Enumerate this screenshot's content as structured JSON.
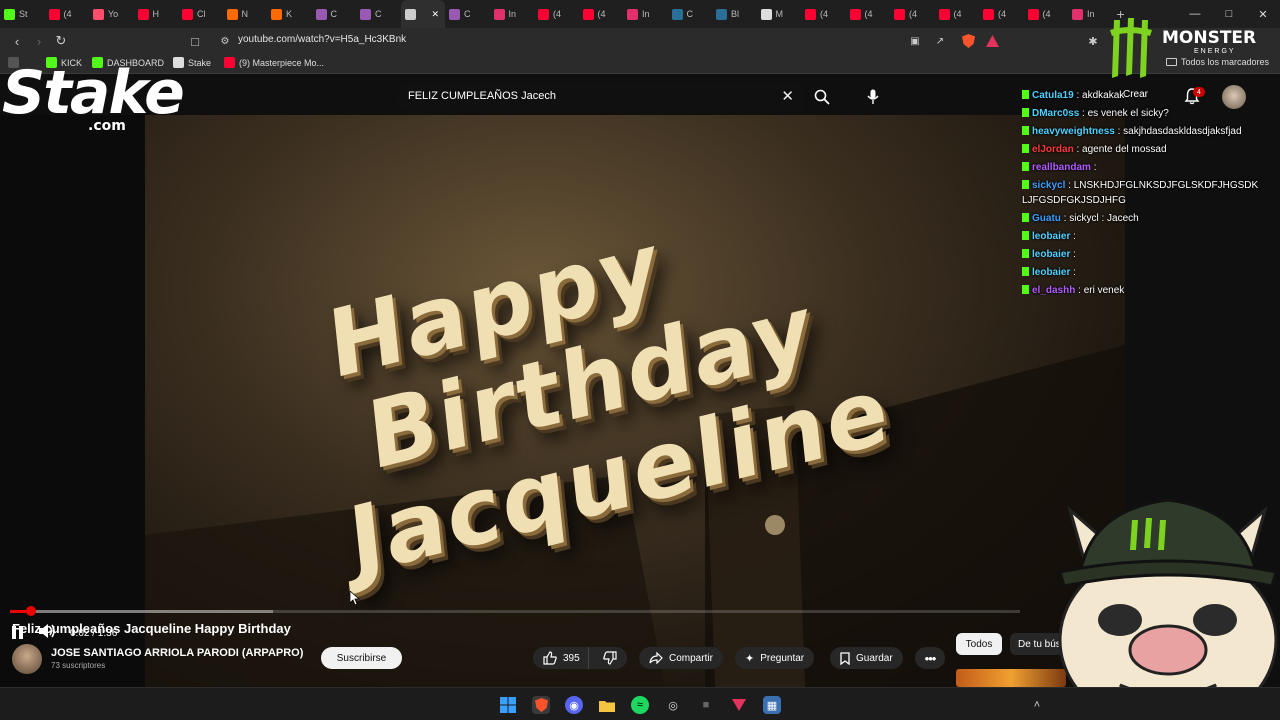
{
  "browser": {
    "tabs": [
      {
        "label": "St",
        "color": "#53fc18"
      },
      {
        "label": "(4",
        "color": "#ff0033"
      },
      {
        "label": "Yo",
        "color": "#ff4d6d"
      },
      {
        "label": "H",
        "color": "#ff0033"
      },
      {
        "label": "Cl",
        "color": "#ff0033"
      },
      {
        "label": "N",
        "color": "#ff6a00"
      },
      {
        "label": "K",
        "color": "#ff6a00"
      },
      {
        "label": "C",
        "color": "#9b59b6"
      },
      {
        "label": "C",
        "color": "#9b59b6"
      },
      {
        "label": "",
        "color": "#cccccc"
      },
      {
        "label": "C",
        "color": "#9b59b6"
      },
      {
        "label": "In",
        "color": "#e1306c"
      },
      {
        "label": "(4",
        "color": "#ff0033"
      },
      {
        "label": "(4",
        "color": "#ff0033"
      },
      {
        "label": "In",
        "color": "#e1306c"
      },
      {
        "label": "C",
        "color": "#2a6f97"
      },
      {
        "label": "Bl",
        "color": "#2a6f97"
      },
      {
        "label": "M",
        "color": "#dddddd"
      },
      {
        "label": "(4",
        "color": "#ff0033"
      },
      {
        "label": "(4",
        "color": "#ff0033"
      },
      {
        "label": "(4",
        "color": "#ff0033"
      },
      {
        "label": "(4",
        "color": "#ff0033"
      },
      {
        "label": "(4",
        "color": "#ff0033"
      },
      {
        "label": "(4",
        "color": "#ff0033"
      },
      {
        "label": "In",
        "color": "#e1306c"
      }
    ],
    "new_tab": "+",
    "url": "youtube.com/watch?v=H5a_Hc3KBnk",
    "bookmarks": [
      {
        "label": "KICK",
        "color": "#53fc18"
      },
      {
        "label": "DASHBOARD",
        "color": "#53fc18"
      },
      {
        "label": "Stake",
        "color": "#dddddd"
      },
      {
        "label": "(9) Masterpiece Mo...",
        "color": "#ff0033"
      }
    ],
    "all_bookmarks": "Todos los marcadores"
  },
  "youtube": {
    "search_query": "FELIZ CUMPLEAÑOS Jacech",
    "create_label": "Crear",
    "notif_count": "4",
    "video": {
      "overlay_lines": [
        "Happy",
        "Birthday",
        "Jacqueline"
      ],
      "current_time": "0:02",
      "duration": "1:36",
      "timecode": "0:02 / 1:36",
      "played_fraction": 0.021,
      "buffered_fraction": 0.26
    },
    "title": "Feliz cumpleaños Jacqueline Happy Birthday",
    "channel": "JOSE SANTIAGO ARRIOLA PARODI (ARPAPRO)",
    "subscribers": "73 suscriptores",
    "subscribe_label": "Suscribirse",
    "likes": "395",
    "share_label": "Compartir",
    "ask_label": "Preguntar",
    "save_label": "Guardar",
    "filters": [
      "Todos",
      "De tu búsq"
    ]
  },
  "chat": [
    {
      "user": "Catula19",
      "color": "#4fd1ff",
      "text": ": akdkakak"
    },
    {
      "user": "DMarc0ss",
      "color": "#4fd1ff",
      "text": ": es venek el sicky?"
    },
    {
      "user": "heavyweightness",
      "color": "#4fd1ff",
      "text": ": sakjhdasdaskldasdjaksfjad"
    },
    {
      "user": "elJordan",
      "color": "#ff3b3b",
      "text": ": agente del mossad"
    },
    {
      "user": "reallbandam",
      "color": "#b15cff",
      "text": ":"
    },
    {
      "user": "sickycl",
      "color": "#3aa0ff",
      "text": ": LNSKHDJFGLNKSDJFGLSKDFJHGSDKLJFGSDFGKJSDJHFG"
    },
    {
      "user": "Guatu",
      "color": "#3aa0ff",
      "text": ": sickycl : Jacech"
    },
    {
      "user": "leobaier",
      "color": "#4fd1ff",
      "text": ":"
    },
    {
      "user": "leobaier",
      "color": "#4fd1ff",
      "text": ":"
    },
    {
      "user": "leobaier",
      "color": "#4fd1ff",
      "text": ":"
    },
    {
      "user": "el_dashh",
      "color": "#b15cff",
      "text": ": eri venek"
    }
  ],
  "overlays": {
    "stake_word": "Stake",
    "stake_com": ".com",
    "monster_word": "MONSTER",
    "monster_sub": "ENERGY"
  },
  "colors": {
    "accent_red": "#ff0000",
    "kick_green": "#53fc18",
    "monster_green": "#7ed321"
  }
}
